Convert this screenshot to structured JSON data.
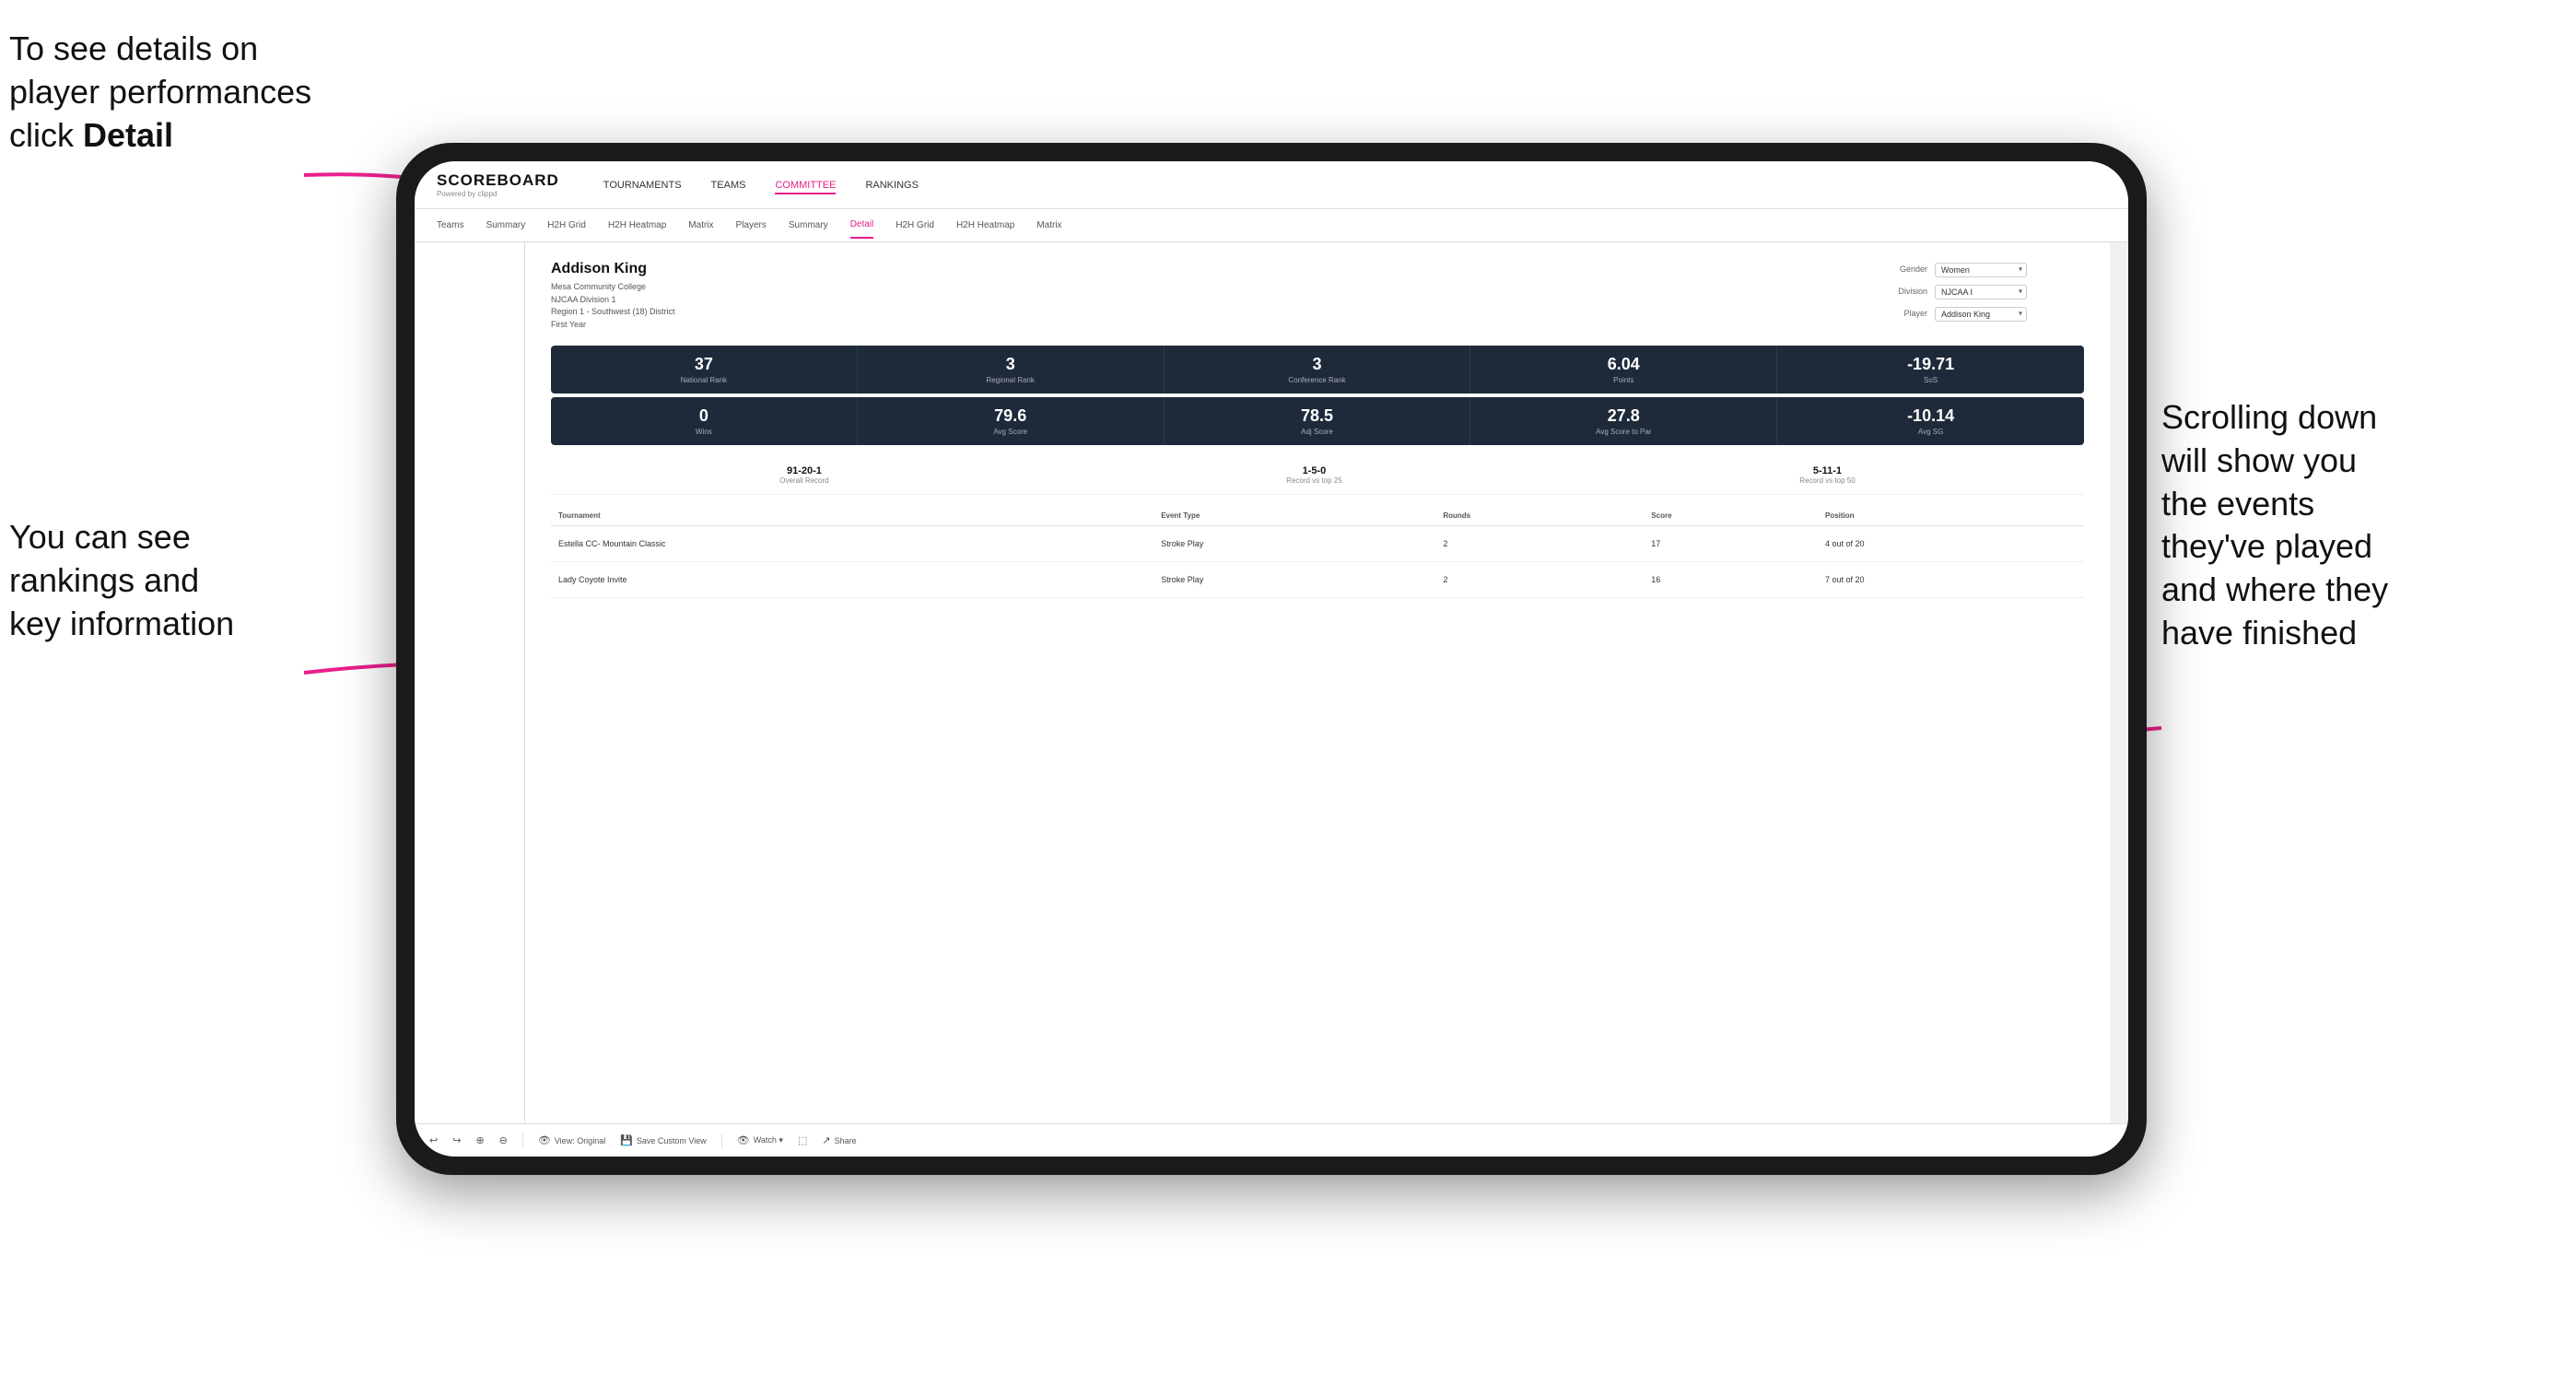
{
  "annotations": {
    "top_left_line1": "To see details on",
    "top_left_line2": "player performances",
    "top_left_line3": "click ",
    "top_left_bold": "Detail",
    "bottom_left_line1": "You can see",
    "bottom_left_line2": "rankings and",
    "bottom_left_line3": "key information",
    "right_line1": "Scrolling down",
    "right_line2": "will show you",
    "right_line3": "the events",
    "right_line4": "they've played",
    "right_line5": "and where they",
    "right_line6": "have finished"
  },
  "nav": {
    "logo_main": "SCOREBOARD",
    "logo_sub": "Powered by clippd",
    "items": [
      "TOURNAMENTS",
      "TEAMS",
      "COMMITTEE",
      "RANKINGS"
    ]
  },
  "sub_nav": {
    "items": [
      "Teams",
      "Summary",
      "H2H Grid",
      "H2H Heatmap",
      "Matrix",
      "Players",
      "Summary",
      "Detail",
      "H2H Grid",
      "H2H Heatmap",
      "Matrix"
    ],
    "active": "Detail"
  },
  "player": {
    "name": "Addison King",
    "school": "Mesa Community College",
    "division": "NJCAA Division 1",
    "region": "Region 1 - Southwest (18) District",
    "year": "First Year"
  },
  "selectors": {
    "gender_label": "Gender",
    "gender_value": "Women",
    "division_label": "Division",
    "division_value": "NJCAA I",
    "player_label": "Player",
    "player_value": "Addison King"
  },
  "stats_row1": [
    {
      "value": "37",
      "label": "National Rank"
    },
    {
      "value": "3",
      "label": "Regional Rank"
    },
    {
      "value": "3",
      "label": "Conference Rank"
    },
    {
      "value": "6.04",
      "label": "Points"
    },
    {
      "value": "-19.71",
      "label": "SoS"
    }
  ],
  "stats_row2": [
    {
      "value": "0",
      "label": "Wins"
    },
    {
      "value": "79.6",
      "label": "Avg Score"
    },
    {
      "value": "78.5",
      "label": "Adj Score"
    },
    {
      "value": "27.8",
      "label": "Avg Score to Par"
    },
    {
      "value": "-10.14",
      "label": "Avg SG"
    }
  ],
  "records": [
    {
      "value": "91-20-1",
      "label": "Overall Record"
    },
    {
      "value": "1-5-0",
      "label": "Record vs top 25"
    },
    {
      "value": "5-11-1",
      "label": "Record vs top 50"
    }
  ],
  "table": {
    "headers": [
      "Tournament",
      "Event Type",
      "Rounds",
      "Score",
      "Position"
    ],
    "rows": [
      {
        "tournament": "Estella CC- Mountain Classic",
        "event_type": "Stroke Play",
        "rounds": "2",
        "score": "17",
        "position": "4 out of 20"
      },
      {
        "tournament": "Lady Coyote Invite",
        "event_type": "Stroke Play",
        "rounds": "2",
        "score": "16",
        "position": "7 out of 20"
      }
    ]
  },
  "toolbar": {
    "items": [
      "↩",
      "↪",
      "⊕",
      "⊖",
      "✕",
      "⏱",
      "👁 View: Original",
      "💾 Save Custom View",
      "👁 Watch ▾",
      "⬚",
      "↗ Share"
    ]
  }
}
